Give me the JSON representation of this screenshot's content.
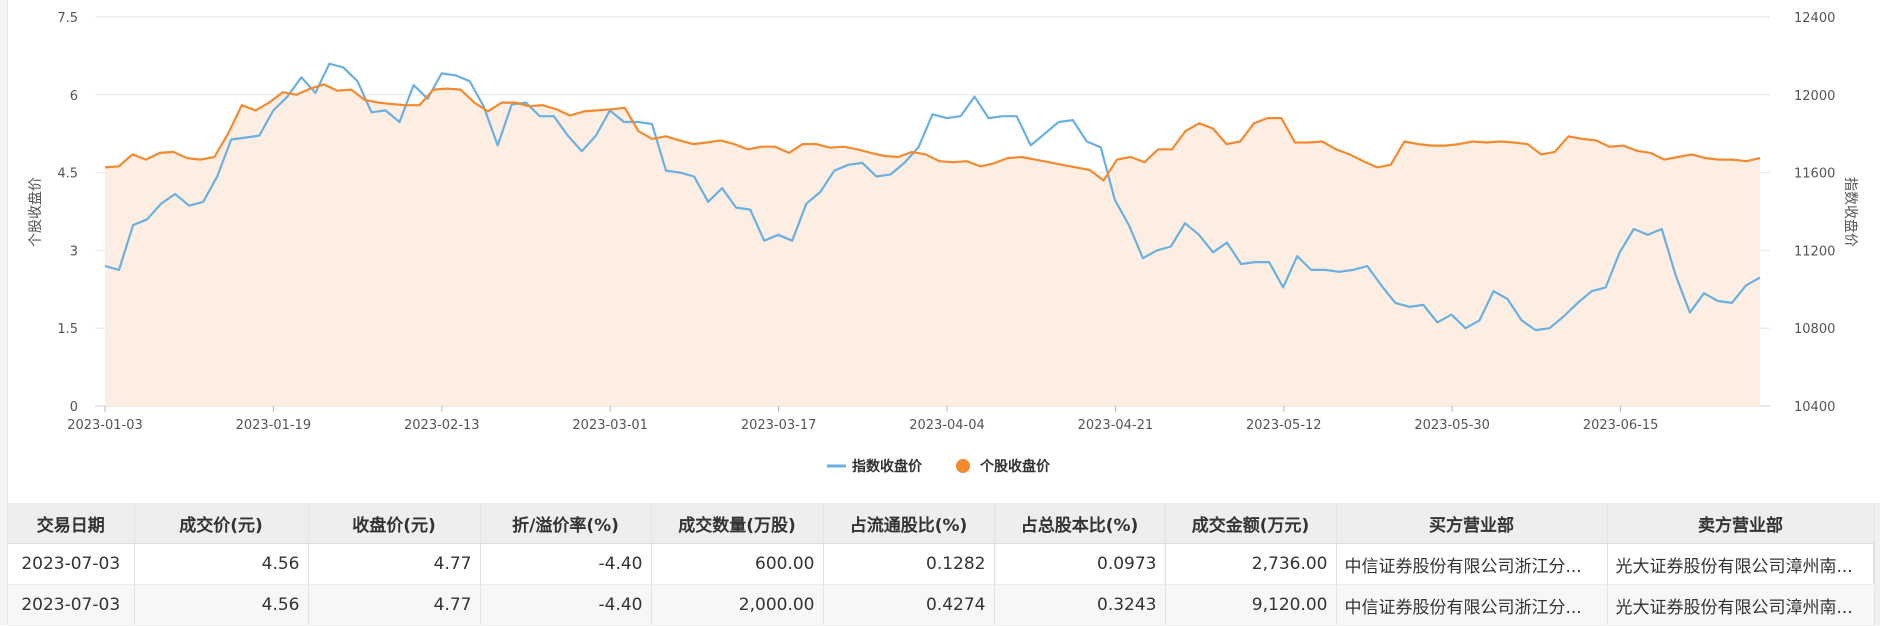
{
  "chart_data": {
    "type": "line",
    "x_tick_labels": [
      "2023-01-03",
      "2023-01-19",
      "2023-02-13",
      "2023-03-01",
      "2023-03-17",
      "2023-04-04",
      "2023-04-21",
      "2023-05-12",
      "2023-05-30",
      "2023-06-15"
    ],
    "left_axis": {
      "title": "个股收盘价",
      "ticks": [
        "0",
        "1.5",
        "3",
        "4.5",
        "6",
        "7.5"
      ],
      "ylim": [
        0,
        7.5
      ]
    },
    "right_axis": {
      "title": "指数收盘价",
      "ticks": [
        "10400",
        "10800",
        "11200",
        "11600",
        "12000",
        "12400"
      ],
      "ylim": [
        10400,
        12400
      ]
    },
    "legend_position": "bottom-center",
    "series": [
      {
        "name": "指数收盘价",
        "axis": "right",
        "color": "#6ab0e0",
        "area": false,
        "values": [
          11120,
          11100,
          11330,
          11360,
          11440,
          11490,
          11430,
          11450,
          11580,
          11770,
          11780,
          11790,
          11920,
          11990,
          12090,
          12010,
          12160,
          12140,
          12070,
          11910,
          11920,
          11860,
          12050,
          11980,
          12110,
          12100,
          12070,
          11940,
          11740,
          11950,
          11960,
          11890,
          11890,
          11790,
          11710,
          11790,
          11920,
          11860,
          11860,
          11850,
          11610,
          11600,
          11580,
          11450,
          11520,
          11420,
          11410,
          11250,
          11280,
          11250,
          11440,
          11500,
          11610,
          11640,
          11650,
          11580,
          11590,
          11650,
          11730,
          11900,
          11880,
          11890,
          11990,
          11880,
          11890,
          11890,
          11740,
          11800,
          11860,
          11870,
          11760,
          11730,
          11460,
          11330,
          11160,
          11200,
          11220,
          11340,
          11280,
          11190,
          11240,
          11130,
          11140,
          11140,
          11010,
          11170,
          11100,
          11100,
          11090,
          11100,
          11120,
          11020,
          10930,
          10910,
          10920,
          10830,
          10870,
          10800,
          10840,
          10990,
          10950,
          10840,
          10790,
          10800,
          10860,
          10930,
          10990,
          11010,
          11190,
          11310,
          11280,
          11310,
          11070,
          10880,
          10980,
          10940,
          10930,
          11020,
          11060
        ]
      },
      {
        "name": "个股收盘价",
        "axis": "left",
        "color": "#f28a30",
        "area": true,
        "area_color": "#fdeee3",
        "values": [
          4.6,
          4.62,
          4.85,
          4.75,
          4.88,
          4.9,
          4.78,
          4.75,
          4.8,
          5.25,
          5.8,
          5.7,
          5.85,
          6.05,
          6.0,
          6.12,
          6.2,
          6.08,
          6.1,
          5.9,
          5.85,
          5.82,
          5.8,
          5.8,
          6.1,
          6.12,
          6.1,
          5.85,
          5.68,
          5.85,
          5.85,
          5.78,
          5.8,
          5.72,
          5.6,
          5.68,
          5.7,
          5.72,
          5.75,
          5.3,
          5.15,
          5.2,
          5.12,
          5.05,
          5.08,
          5.12,
          5.05,
          4.95,
          5.0,
          5.0,
          4.88,
          5.05,
          5.05,
          4.98,
          5.0,
          4.95,
          4.88,
          4.82,
          4.8,
          4.9,
          4.85,
          4.72,
          4.7,
          4.72,
          4.62,
          4.68,
          4.78,
          4.8,
          4.75,
          4.7,
          4.65,
          4.6,
          4.55,
          4.35,
          4.75,
          4.8,
          4.7,
          4.95,
          4.95,
          5.3,
          5.45,
          5.35,
          5.05,
          5.1,
          5.45,
          5.55,
          5.55,
          5.08,
          5.08,
          5.1,
          4.95,
          4.85,
          4.72,
          4.6,
          4.65,
          5.1,
          5.05,
          5.02,
          5.02,
          5.05,
          5.1,
          5.08,
          5.1,
          5.08,
          5.05,
          4.85,
          4.9,
          5.2,
          5.15,
          5.12,
          5.0,
          5.02,
          4.92,
          4.88,
          4.75,
          4.8,
          4.85,
          4.78,
          4.75,
          4.75,
          4.72,
          4.78
        ]
      }
    ]
  },
  "table": {
    "headers": [
      "交易日期",
      "成交价(元)",
      "收盘价(元)",
      "折/溢价率(%)",
      "成交数量(万股)",
      "占流通股比(%)",
      "占总股本比(%)",
      "成交金额(万元)",
      "买方营业部",
      "卖方营业部"
    ],
    "rows": [
      [
        "2023-07-03",
        "4.56",
        "4.77",
        "-4.40",
        "600.00",
        "0.1282",
        "0.0973",
        "2,736.00",
        "中信证券股份有限公司浙江分...",
        "光大证券股份有限公司漳州南..."
      ],
      [
        "2023-07-03",
        "4.56",
        "4.77",
        "-4.40",
        "2,000.00",
        "0.4274",
        "0.3243",
        "9,120.00",
        "中信证券股份有限公司浙江分...",
        "光大证券股份有限公司漳州南..."
      ]
    ]
  }
}
